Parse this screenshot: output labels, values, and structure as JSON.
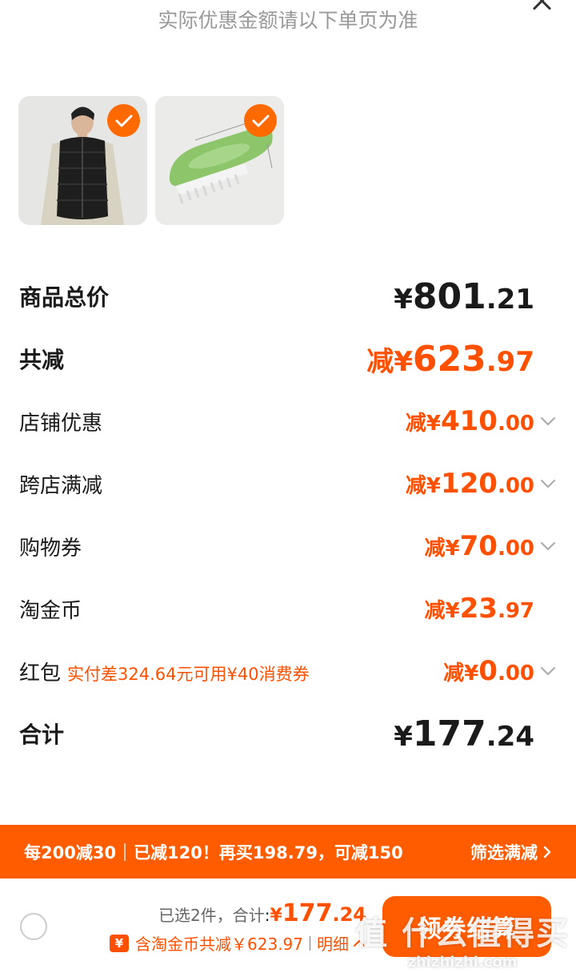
{
  "header": {
    "notice": "实际优惠金额请以下单页为准",
    "close_icon": "close-icon"
  },
  "products": [
    {
      "name": "black-puffer-vest",
      "selected": true
    },
    {
      "name": "green-scrub-brush",
      "selected": true
    }
  ],
  "summary": {
    "total": {
      "label": "商品总价",
      "yen": "¥",
      "int": "801",
      "dec": ".21"
    },
    "discount_total": {
      "label": "共减",
      "prefix": "减¥",
      "int": "623",
      "dec": ".97"
    },
    "items": [
      {
        "label": "店铺优惠",
        "prefix": "减¥",
        "int": "410",
        "dec": ".00",
        "has_chevron": true
      },
      {
        "label": "跨店满减",
        "prefix": "减¥",
        "int": "120",
        "dec": ".00",
        "has_chevron": true
      },
      {
        "label": "购物券",
        "prefix": "减¥",
        "int": "70",
        "dec": ".00",
        "has_chevron": true
      },
      {
        "label": "淘金币",
        "prefix": "减¥",
        "int": "23",
        "dec": ".97",
        "has_chevron": false
      },
      {
        "label": "红包",
        "hint": "实付差324.64元可用¥40消费券",
        "prefix": "减¥",
        "int": "0",
        "dec": ".00",
        "has_chevron": true
      }
    ],
    "grand_total": {
      "label": "合计",
      "yen": "¥",
      "int": "177",
      "dec": ".24"
    }
  },
  "promo_bar": {
    "rule": "每200减30",
    "saved": "已减120！再买198.79，可减150",
    "filter_label": "筛选满减"
  },
  "footer": {
    "selected_text": "已选2件，合计",
    "colon": ":",
    "total_prefix": "¥",
    "total_int": "177",
    "total_dec": ".24",
    "coin_badge": "¥",
    "coin_text": "含淘金币共减￥623.97",
    "detail_label": "明细",
    "claim_button": "领券结算"
  },
  "watermark": {
    "cn": "值 什么值得买",
    "en": "zhizhizhi.com"
  },
  "colors": {
    "accent": "#ff5000",
    "promo_bg": "#ff5c00",
    "muted": "#999999"
  }
}
